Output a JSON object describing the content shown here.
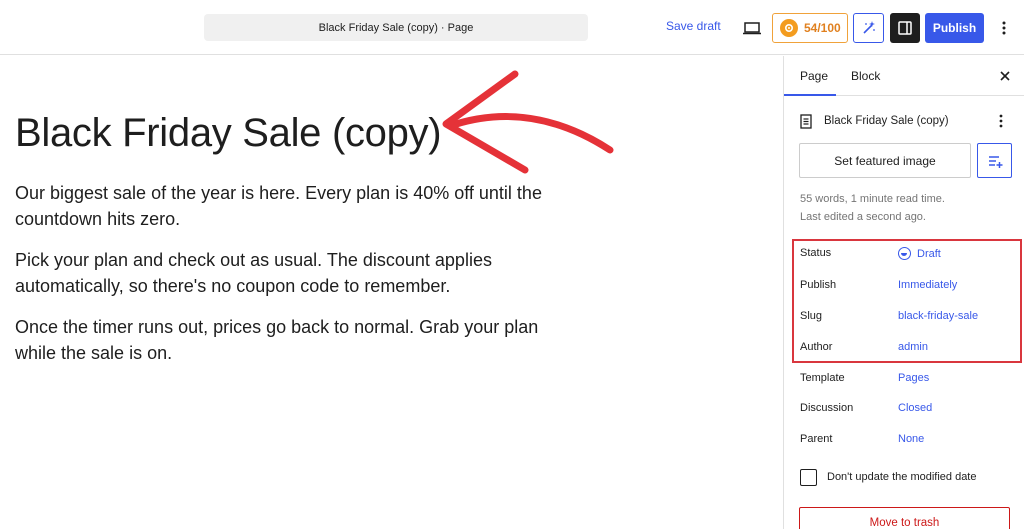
{
  "topbar": {
    "document_title": "Black Friday Sale (copy) · Page",
    "save_draft_label": "Save draft",
    "score": "54/100",
    "publish_label": "Publish",
    "icons": [
      "desktop-icon",
      "score-icon",
      "ai-wand-icon",
      "sidebar-toggle-icon",
      "more-vertical-icon"
    ]
  },
  "content": {
    "title": "Black Friday Sale (copy)",
    "paragraphs": [
      "Our biggest sale of the year is here. Every plan is 40% off until the countdown hits zero.",
      "Pick your plan and check out as usual. The discount applies automatically, so there's no coupon code to remember.",
      "Once the timer runs out, prices go back to normal. Grab your plan while the sale is on."
    ]
  },
  "sidebar": {
    "tabs": [
      "Page",
      "Block"
    ],
    "active_tab": "Page",
    "doc_title": "Black Friday Sale (copy)",
    "featured_image_label": "Set featured image",
    "word_count": "55 words, 1 minute read time.",
    "last_edited": "Last edited a second ago.",
    "properties": {
      "status_label": "Status",
      "status_value": "Draft",
      "publish_label": "Publish",
      "publish_value": "Immediately",
      "slug_label": "Slug",
      "slug_value": "black-friday-sale",
      "author_label": "Author",
      "author_value": "admin",
      "template_label": "Template",
      "template_value": "Pages",
      "discussion_label": "Discussion",
      "discussion_value": "Closed",
      "parent_label": "Parent",
      "parent_value": "None"
    },
    "modified_date_label": "Don't update the modified date",
    "trash_label": "Move to trash"
  },
  "colors": {
    "accent": "#3858e9",
    "annotation_red": "#d9363e",
    "score_orange": "#f39c1f",
    "trash_red": "#cc1818"
  }
}
